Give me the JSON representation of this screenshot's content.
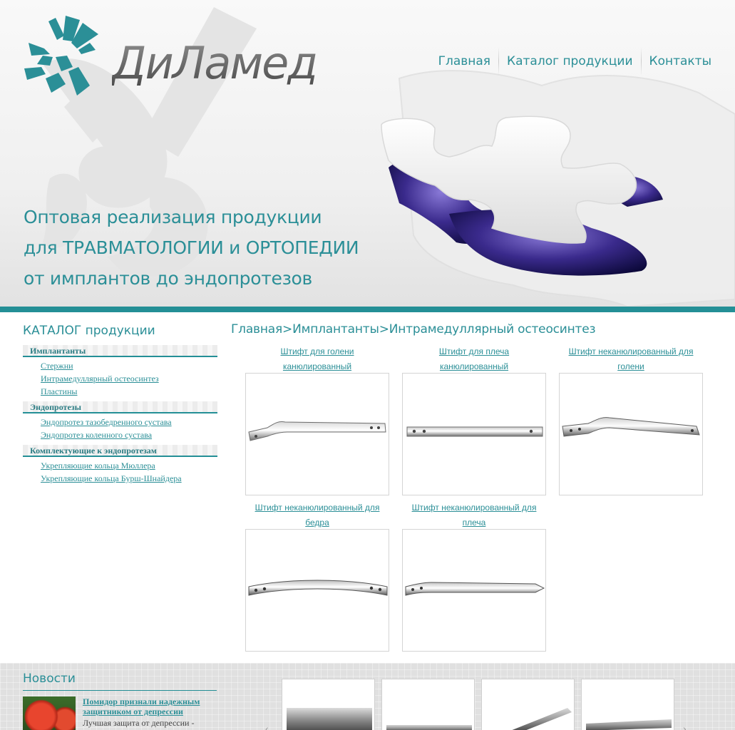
{
  "brand": {
    "name": "ДиЛамед",
    "accent_color": "#2b8f97"
  },
  "nav": {
    "items": [
      {
        "label": "Главная"
      },
      {
        "label": "Каталог продукции"
      },
      {
        "label": "Контакты"
      }
    ]
  },
  "slogan": {
    "line1": "Оптовая реализация продукции",
    "line2": "для ТРАВМАТОЛОГИИ и ОРТОПЕДИИ",
    "line3": "от имплантов до эндопротезов"
  },
  "sidebar": {
    "title": "КАТАЛОГ продукции",
    "categories": [
      {
        "name": "Имплантанты",
        "items": [
          "Стержни",
          "Интрамедуллярный остеосинтез",
          "Пластины"
        ]
      },
      {
        "name": "Эндопротезы",
        "items": [
          "Эндопротез тазобедренного сустава",
          "Эндопротез коленного сустава"
        ]
      },
      {
        "name": "Комплектующие к эндопротезам",
        "items": [
          "Укрепляющие кольца Мюллера",
          "Укрепляющие кольца Бурш-Шнайдера"
        ]
      }
    ]
  },
  "breadcrumb": {
    "items": [
      "Главная",
      "Имплантанты",
      "Интрамедуллярный остеосинтез"
    ],
    "separator": ">"
  },
  "products": [
    {
      "title_line1": "Штифт для голени",
      "title_line2": "канюлированный"
    },
    {
      "title_line1": "Штифт для плеча",
      "title_line2": "канюлированный"
    },
    {
      "title_line1": "Штифт неканюлированный для",
      "title_line2": "голени"
    },
    {
      "title_line1": "Штифт неканюлированный для",
      "title_line2": "бедра"
    },
    {
      "title_line1": "Штифт неканюлированный для",
      "title_line2": "плеча"
    }
  ],
  "news": {
    "title": "Новости",
    "items": [
      {
        "headline": "Помидор признали надежным защитником от депрессии",
        "excerpt": "Лучшая защита от депрессии -"
      }
    ]
  },
  "icons": {
    "logo": "dilamed-logo-icon",
    "slider_prev": "chevron-left-icon",
    "slider_next": "chevron-right-icon"
  }
}
